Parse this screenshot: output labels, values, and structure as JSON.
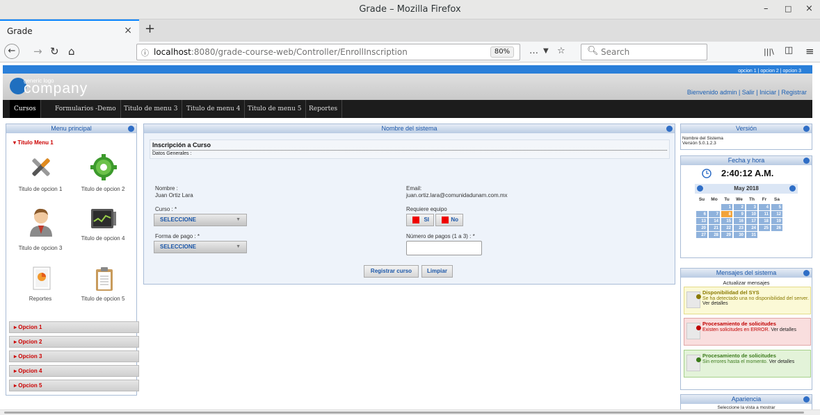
{
  "window": {
    "title": "Grade – Mozilla Firefox",
    "minimize": "–",
    "maximize": "□",
    "close": "×"
  },
  "tab": {
    "label": "Grade",
    "close": "×",
    "new_tab": "+"
  },
  "navbar": {
    "back": "←",
    "forward": "→",
    "reload": "↻",
    "home": "⌂",
    "url_host": "localhost",
    "url_rest": ":8080/grade-course-web/Controller/EnrollInscription",
    "zoom": "80%",
    "search_placeholder": "Search",
    "info_icon": "ⓘ",
    "more": "…",
    "pocket": "▼",
    "bookmark": "☆",
    "library": "|||\\",
    "sidebar": "◫",
    "menu": "≡"
  },
  "site": {
    "top_links": "opcion 1 | opcion 2 | opcion 3",
    "logo_small": "generic logo",
    "logo_big": "company",
    "user_links": "Bienvenido admin  |  Salir |  Iniciar |  Registrar",
    "menu": [
      "Cursos",
      "Formularios -Demo",
      "Titulo de menu 3",
      "Titulo de menu 4",
      "Titulo de menu 5",
      "Reportes"
    ]
  },
  "left_panel": {
    "title": "Menu principal",
    "section": "▾ Titulo Menu 1",
    "icons": [
      {
        "label": "Titulo de opcion 1",
        "icon": "tools-icon"
      },
      {
        "label": "Titulo de opcion 2",
        "icon": "gear-icon"
      },
      {
        "label": "Titulo de opcion 3",
        "icon": "user-icon"
      },
      {
        "label": "Titulo de opcion 4",
        "icon": "monitor-icon"
      },
      {
        "label": "Reportes",
        "icon": "report-icon"
      },
      {
        "label": "Titulo de opcion 5",
        "icon": "clipboard-icon"
      }
    ],
    "options": [
      "▸ Opcion 1",
      "▸ Opcion 2",
      "▸ Opcion 3",
      "▸ Opcion 4",
      "▸ Opcion 5"
    ]
  },
  "main": {
    "title": "Nombre del sistema",
    "heading": "Inscripción a Curso",
    "subheading": "Datos Generales :",
    "nombre_label": "Nombre :",
    "nombre_value": "Juan Ortiz Lara",
    "email_label": "Email:",
    "email_value": "juan.ortiz.lara@comunidadunam.com.mx",
    "curso_label": "Curso : *",
    "curso_value": "SELECCIONE",
    "equipo_label": "Requiere equipo",
    "si_label": "SI",
    "no_label": "No",
    "pago_label": "Forma de pago : *",
    "pago_value": "SELECCIONE",
    "num_pagos_label": "Número de pagos (1 a 3) : *",
    "num_pagos_value": "",
    "register_button": "Registrar curso",
    "clear_button": "Limpiar"
  },
  "version_panel": {
    "title": "Versión",
    "line1": "Nombre del Sistema",
    "line2": "Versión 5.0.1.2.3"
  },
  "datetime_panel": {
    "title": "Fecha y hora",
    "time": "2:40:12 A.M.",
    "month": "May 2018",
    "weekdays": [
      "Su",
      "Mo",
      "Tu",
      "We",
      "Th",
      "Fr",
      "Sa"
    ],
    "weeks": [
      [
        "",
        "",
        "1",
        "2",
        "3",
        "4",
        "5"
      ],
      [
        "6",
        "7",
        "8",
        "9",
        "10",
        "11",
        "12"
      ],
      [
        "13",
        "14",
        "15",
        "16",
        "17",
        "18",
        "19"
      ],
      [
        "20",
        "21",
        "22",
        "23",
        "24",
        "25",
        "26"
      ],
      [
        "27",
        "28",
        "29",
        "30",
        "31",
        "",
        ""
      ]
    ],
    "today": "8"
  },
  "messages_panel": {
    "title": "Mensajes del sistema",
    "refresh": "Actualizar mensajes",
    "messages": [
      {
        "title": "Disponibilidad del SYS",
        "body": "Se ha detectado una no disponibilidad del server.",
        "link": "Ver detalles",
        "bg": "#fbf9d6",
        "border": "#e4dc8a",
        "title_color": "#8a7a00",
        "icon": "warning-icon"
      },
      {
        "title": "Procesamiento de solicitudes",
        "body": "Existen solicitudes en ERROR.",
        "link": "Ver detalles",
        "bg": "#f9dede",
        "border": "#e0a6a6",
        "title_color": "#c00000",
        "icon": "error-icon"
      },
      {
        "title": "Procesamiento de solicitudes",
        "body": "Sin errores hasta el momento.",
        "link": "Ver detalles",
        "bg": "#e3f3d9",
        "border": "#a6d08a",
        "title_color": "#3b7a1b",
        "icon": "ok-icon"
      }
    ]
  },
  "appearance_panel": {
    "title": "Apariencia",
    "line": "Seleccione la vista a mostrar"
  }
}
